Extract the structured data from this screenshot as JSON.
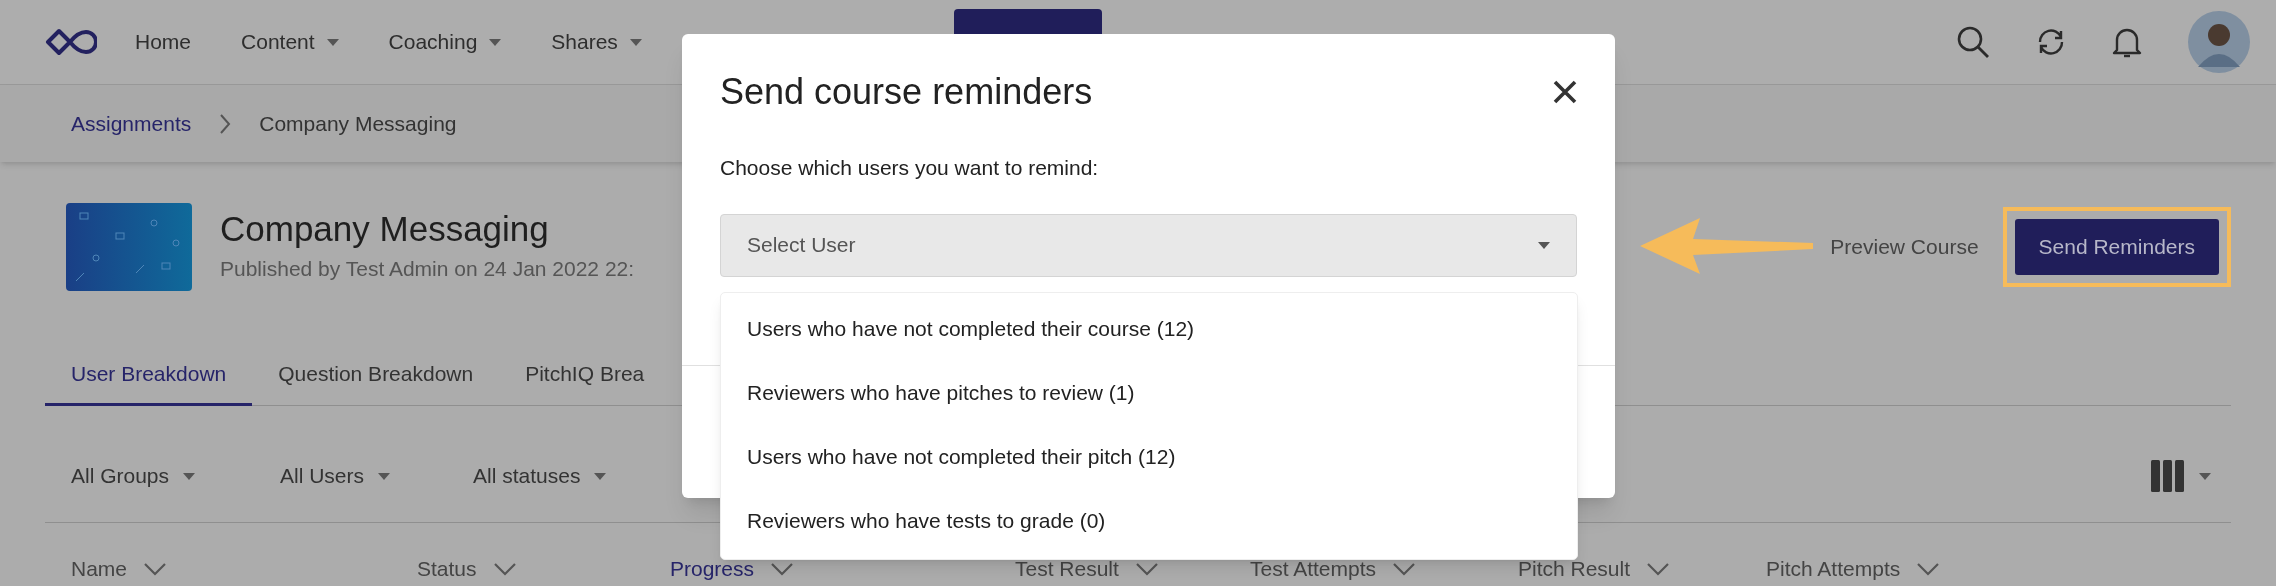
{
  "nav": {
    "items": [
      {
        "label": "Home",
        "dropdown": false
      },
      {
        "label": "Content",
        "dropdown": true
      },
      {
        "label": "Coaching",
        "dropdown": true
      },
      {
        "label": "Shares",
        "dropdown": true
      }
    ]
  },
  "breadcrumb": [
    "Assignments",
    "Company Messaging"
  ],
  "course": {
    "title": "Company Messaging",
    "subtitle": "Published by Test Admin on 24 Jan 2022 22:"
  },
  "actions": {
    "preview": "Preview Course",
    "send": "Send Reminders",
    "send_highlighted": true
  },
  "tabs": [
    {
      "label": "User Breakdown",
      "selected": true
    },
    {
      "label": "Question Breakdown",
      "selected": false
    },
    {
      "label": "PitchIQ Brea",
      "selected": false
    }
  ],
  "filters": [
    "All Groups",
    "All Users",
    "All statuses"
  ],
  "columns_menu": {
    "expanded": false
  },
  "columns": [
    {
      "label": "Name",
      "active": false
    },
    {
      "label": "Status",
      "active": false
    },
    {
      "label": "Progress",
      "active": true
    },
    {
      "label": "Test Result",
      "active": false
    },
    {
      "label": "Test Attempts",
      "active": false
    },
    {
      "label": "Pitch Result",
      "active": false
    },
    {
      "label": "Pitch Attempts",
      "active": false
    }
  ],
  "modal": {
    "title": "Send course reminders",
    "prompt": "Choose which users you want to remind:",
    "select": {
      "placeholder": "Select User"
    },
    "options": [
      "Users who have not completed their course (12)",
      "Reviewers who have pitches to review (1)",
      "Users who have not completed their pitch (12)",
      "Reviewers who have tests to grade (0)"
    ]
  }
}
